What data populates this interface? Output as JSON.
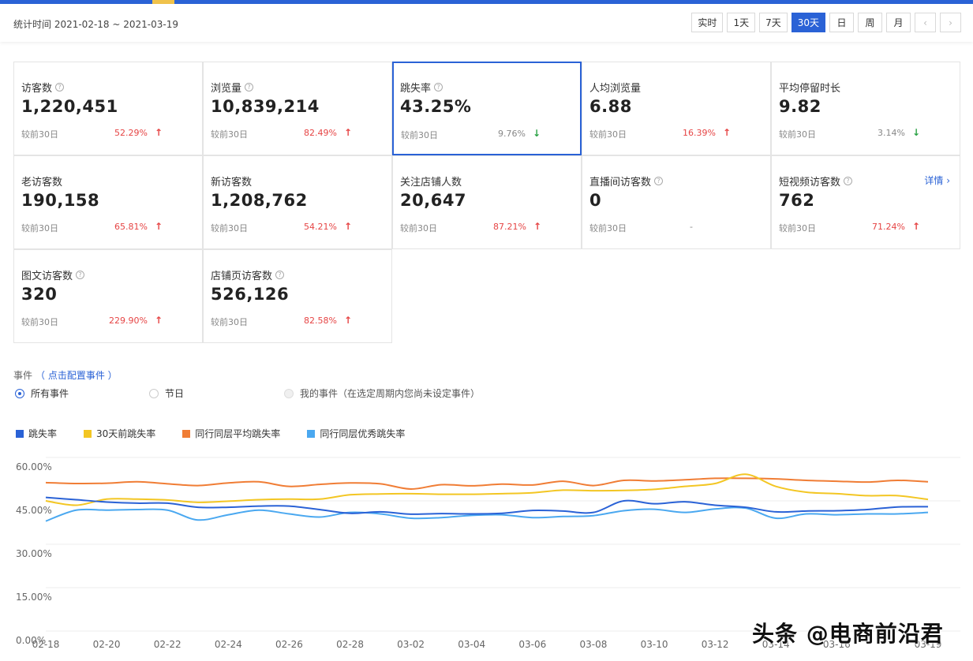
{
  "header": {
    "date_range": "统计时间 2021-02-18 ~ 2021-03-19",
    "periods": [
      "实时",
      "1天",
      "7天",
      "30天",
      "日",
      "周",
      "月"
    ],
    "active_period": "30天",
    "prev_icon": "chevron-left-icon",
    "next_icon": "chevron-right-icon"
  },
  "metrics": [
    {
      "label": "访客数",
      "value": "1,220,451",
      "compare": "较前30日",
      "pct": "52.29%",
      "trend": "up",
      "help": true
    },
    {
      "label": "浏览量",
      "value": "10,839,214",
      "compare": "较前30日",
      "pct": "82.49%",
      "trend": "up",
      "help": true
    },
    {
      "label": "跳失率",
      "value": "43.25%",
      "compare": "较前30日",
      "pct": "9.76%",
      "trend": "down",
      "help": true,
      "selected": true
    },
    {
      "label": "人均浏览量",
      "value": "6.88",
      "compare": "较前30日",
      "pct": "16.39%",
      "trend": "up",
      "help": false
    },
    {
      "label": "平均停留时长",
      "value": "9.82",
      "compare": "较前30日",
      "pct": "3.14%",
      "trend": "down",
      "help": false
    },
    {
      "label": "老访客数",
      "value": "190,158",
      "compare": "较前30日",
      "pct": "65.81%",
      "trend": "up",
      "help": false
    },
    {
      "label": "新访客数",
      "value": "1,208,762",
      "compare": "较前30日",
      "pct": "54.21%",
      "trend": "up",
      "help": false
    },
    {
      "label": "关注店铺人数",
      "value": "20,647",
      "compare": "较前30日",
      "pct": "87.21%",
      "trend": "up",
      "help": false
    },
    {
      "label": "直播间访客数",
      "value": "0",
      "compare": "较前30日",
      "pct": "-",
      "trend": "none",
      "help": true
    },
    {
      "label": "短视频访客数",
      "value": "762",
      "compare": "较前30日",
      "pct": "71.24%",
      "trend": "up",
      "help": true,
      "detail": "详情 ›"
    },
    {
      "label": "图文访客数",
      "value": "320",
      "compare": "较前30日",
      "pct": "229.90%",
      "trend": "up",
      "help": true
    },
    {
      "label": "店铺页访客数",
      "value": "526,126",
      "compare": "较前30日",
      "pct": "82.58%",
      "trend": "up",
      "help": true
    }
  ],
  "events": {
    "title": "事件",
    "config_link": "（ 点击配置事件 ）",
    "options": [
      {
        "label": "所有事件",
        "state": "checked"
      },
      {
        "label": "节日",
        "state": "unchecked"
      },
      {
        "label": "我的事件（在选定周期内您尚未设定事件）",
        "state": "disabled"
      }
    ]
  },
  "colors": {
    "brand": "#2a62d6",
    "up": "#e64545",
    "down": "#2ba245"
  },
  "chart_data": {
    "type": "line",
    "title": "",
    "xlabel": "",
    "ylabel": "",
    "ylim": [
      0,
      60
    ],
    "y_ticks": [
      "60.00%",
      "45.00%",
      "30.00%",
      "15.00%",
      "0.00%"
    ],
    "x": [
      "02-18",
      "02-19",
      "02-20",
      "02-21",
      "02-22",
      "02-23",
      "02-24",
      "02-25",
      "02-26",
      "02-27",
      "02-28",
      "03-01",
      "03-02",
      "03-03",
      "03-04",
      "03-05",
      "03-06",
      "03-07",
      "03-08",
      "03-09",
      "03-10",
      "03-11",
      "03-12",
      "03-13",
      "03-14",
      "03-15",
      "03-16",
      "03-17",
      "03-18",
      "03-19"
    ],
    "x_tick_labels": [
      "02-18",
      "02-20",
      "02-22",
      "02-24",
      "02-26",
      "02-28",
      "03-02",
      "03-04",
      "03-06",
      "03-08",
      "03-10",
      "03-12",
      "03-14",
      "03-16",
      "03-19"
    ],
    "grid": true,
    "legend_position": "top-left",
    "series": [
      {
        "name": "跳失率",
        "color": "#2a62d6",
        "values": [
          46.2,
          45.4,
          44.6,
          44.2,
          44.2,
          42.8,
          42.8,
          43.2,
          43.2,
          42.0,
          40.7,
          41.2,
          40.4,
          40.6,
          40.5,
          40.7,
          41.7,
          41.5,
          41.0,
          45.0,
          44.0,
          44.7,
          43.5,
          42.8,
          41.2,
          41.5,
          41.6,
          42.0,
          42.9,
          43.0
        ]
      },
      {
        "name": "30天前跳失率",
        "color": "#f3c623",
        "values": [
          45.0,
          43.5,
          45.6,
          45.6,
          45.3,
          44.5,
          44.9,
          45.4,
          45.6,
          45.6,
          47.1,
          47.4,
          47.5,
          47.3,
          47.3,
          47.5,
          47.8,
          48.7,
          48.5,
          48.6,
          49.0,
          50.0,
          51.0,
          54.2,
          50.0,
          48.0,
          47.5,
          46.8,
          46.8,
          45.5
        ]
      },
      {
        "name": "同行同层平均跳失率",
        "color": "#f07d35",
        "values": [
          51.3,
          51.0,
          51.1,
          51.6,
          50.9,
          50.3,
          51.2,
          51.6,
          50.0,
          50.7,
          51.2,
          50.9,
          49.1,
          50.6,
          50.2,
          50.8,
          50.5,
          51.8,
          50.3,
          52.1,
          51.9,
          52.3,
          52.8,
          52.8,
          52.6,
          52.1,
          51.8,
          51.5,
          52.1,
          51.6
        ]
      },
      {
        "name": "同行同层优秀跳失率",
        "color": "#4aa8f0",
        "values": [
          38.0,
          41.8,
          41.8,
          42.0,
          41.8,
          38.4,
          40.2,
          41.8,
          40.5,
          39.4,
          41.0,
          40.5,
          39.0,
          39.2,
          40.0,
          40.2,
          39.2,
          39.6,
          39.9,
          41.6,
          42.1,
          41.0,
          42.2,
          42.5,
          39.0,
          40.5,
          40.2,
          40.5,
          40.5,
          41.0
        ]
      }
    ]
  },
  "watermark": "头条 @电商前沿君"
}
